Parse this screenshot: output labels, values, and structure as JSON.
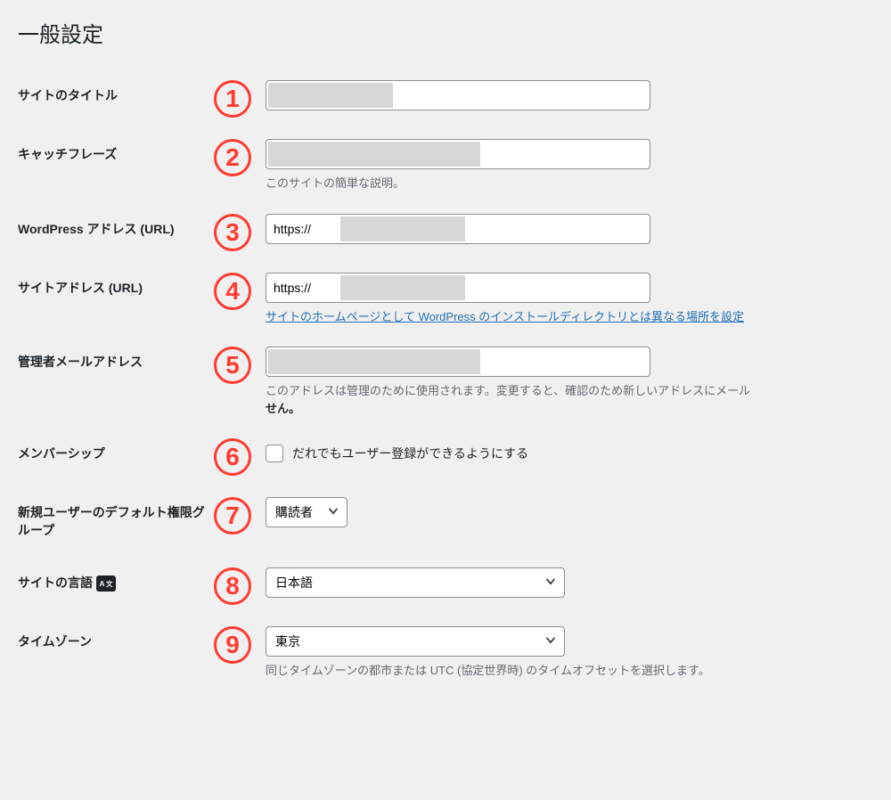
{
  "page_title": "一般設定",
  "markers": {
    "n1": "1",
    "n2": "2",
    "n3": "3",
    "n4": "4",
    "n5": "5",
    "n6": "6",
    "n7": "7",
    "n8": "8",
    "n9": "9"
  },
  "fields": {
    "site_title": {
      "label": "サイトのタイトル",
      "value": ""
    },
    "tagline": {
      "label": "キャッチフレーズ",
      "value": "",
      "description": "このサイトの簡単な説明。"
    },
    "wp_url": {
      "label": "WordPress アドレス (URL)",
      "value": "https://"
    },
    "site_url": {
      "label": "サイトアドレス (URL)",
      "value": "https://",
      "link_text": "サイトのホームページとして WordPress のインストールディレクトリとは異なる場所を設定"
    },
    "admin_email": {
      "label": "管理者メールアドレス",
      "value": "",
      "description": "このアドレスは管理のために使用されます。変更すると、確認のため新しいアドレスにメール",
      "description_bold": "せん。"
    },
    "membership": {
      "label": "メンバーシップ",
      "checkbox_label": "だれでもユーザー登録ができるようにする"
    },
    "default_role": {
      "label": "新規ユーザーのデフォルト権限グループ",
      "value": "購読者"
    },
    "site_lang": {
      "label": "サイトの言語",
      "value": "日本語"
    },
    "timezone": {
      "label": "タイムゾーン",
      "value": "東京",
      "description": "同じタイムゾーンの都市または UTC (協定世界時) のタイムオフセットを選択します。"
    }
  }
}
